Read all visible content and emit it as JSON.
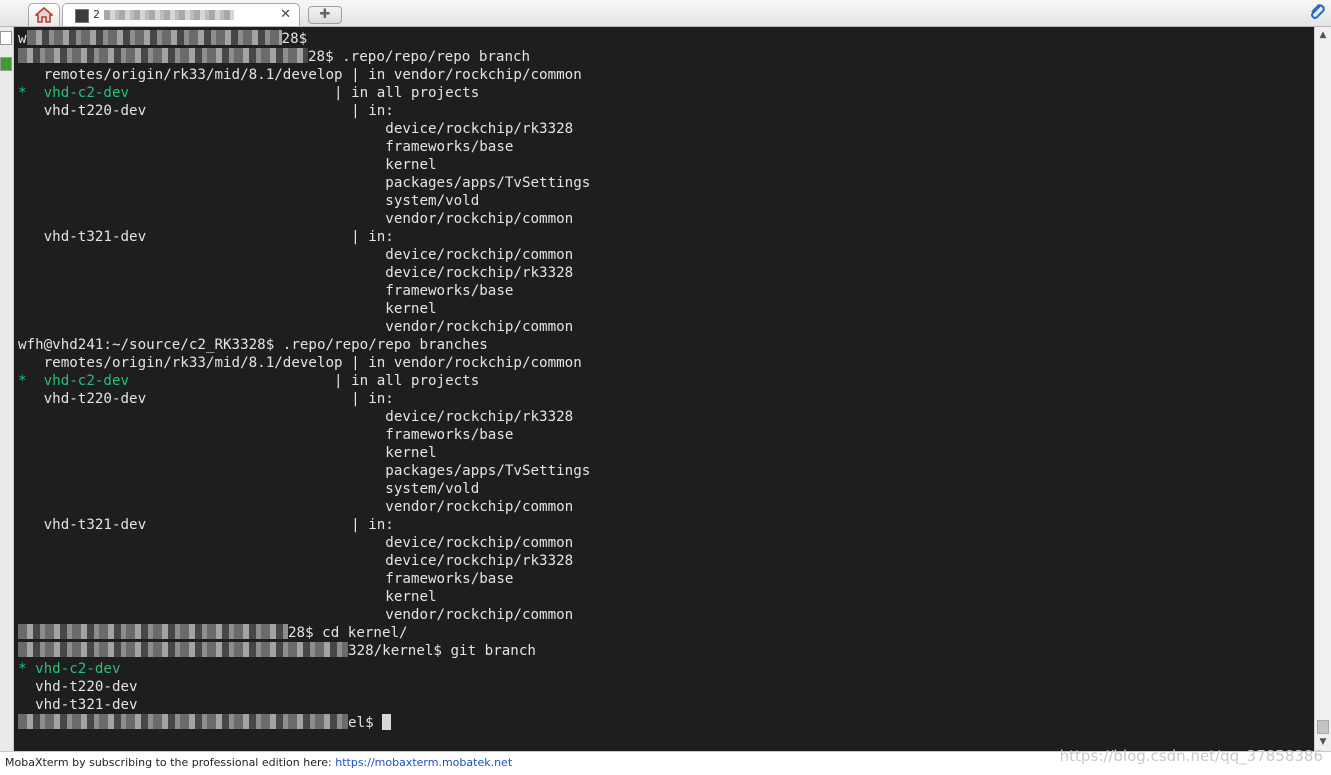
{
  "tabs": {
    "home_icon": "home-icon",
    "session_title_visible": "2",
    "close_glyph": "✕",
    "new_tab_glyph": "✚",
    "attach_icon": "paperclip-icon"
  },
  "terminal": {
    "colors": {
      "background": "#1e1e1e",
      "text": "#e4e4e4",
      "current_branch": "#27c07a"
    },
    "lines": [
      {
        "prefix": "w",
        "redact": 1,
        "text": "28$"
      },
      {
        "redact": 1,
        "text": "28$ .repo/repo/repo branch"
      },
      {
        "text": "   remotes/origin/rk33/mid/8.1/develop | in vendor/rockchip/common"
      },
      {
        "green": "*  vhd-c2-dev",
        "text": "                        | in all projects"
      },
      {
        "text": "   vhd-t220-dev                        | in:"
      },
      {
        "text": "                                           device/rockchip/rk3328"
      },
      {
        "text": "                                           frameworks/base"
      },
      {
        "text": "                                           kernel"
      },
      {
        "text": "                                           packages/apps/TvSettings"
      },
      {
        "text": "                                           system/vold"
      },
      {
        "text": "                                           vendor/rockchip/common"
      },
      {
        "text": "   vhd-t321-dev                        | in:"
      },
      {
        "text": "                                           device/rockchip/common"
      },
      {
        "text": "                                           device/rockchip/rk3328"
      },
      {
        "text": "                                           frameworks/base"
      },
      {
        "text": "                                           kernel"
      },
      {
        "text": "                                           vendor/rockchip/common"
      },
      {
        "text": "wfh@vhd241:~/source/c2_RK3328$ .repo/repo/repo branches"
      },
      {
        "text": "   remotes/origin/rk33/mid/8.1/develop | in vendor/rockchip/common"
      },
      {
        "green": "*  vhd-c2-dev",
        "text": "                        | in all projects"
      },
      {
        "text": "   vhd-t220-dev                        | in:"
      },
      {
        "text": "                                           device/rockchip/rk3328"
      },
      {
        "text": "                                           frameworks/base"
      },
      {
        "text": "                                           kernel"
      },
      {
        "text": "                                           packages/apps/TvSettings"
      },
      {
        "text": "                                           system/vold"
      },
      {
        "text": "                                           vendor/rockchip/common"
      },
      {
        "text": "   vhd-t321-dev                        | in:"
      },
      {
        "text": "                                           device/rockchip/common"
      },
      {
        "text": "                                           device/rockchip/rk3328"
      },
      {
        "text": "                                           frameworks/base"
      },
      {
        "text": "                                           kernel"
      },
      {
        "text": "                                           vendor/rockchip/common"
      },
      {
        "redact": 1,
        "text": "28$ cd kernel/"
      },
      {
        "redact": 1,
        "text": "328/kernel$ git branch"
      },
      {
        "green": "* vhd-c2-dev",
        "text": ""
      },
      {
        "text": "  vhd-t220-dev"
      },
      {
        "text": "  vhd-t321-dev"
      },
      {
        "redact": 1,
        "text": "el$ ",
        "cursor": true
      }
    ]
  },
  "status": {
    "text": "MobaXterm by subscribing to the professional edition here: ",
    "link": "https://mobaxterm.mobatek.net",
    "watermark": "https://blog.csdn.net/qq_37858386"
  }
}
